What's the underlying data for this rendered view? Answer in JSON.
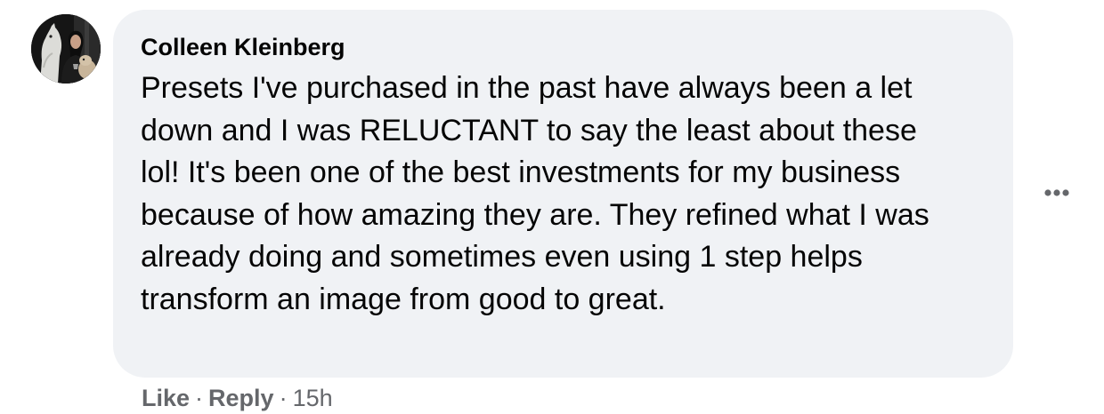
{
  "comment": {
    "author": "Colleen Kleinberg",
    "text": "Presets I've purchased in the past have always been a let down and I was RELUCTANT to say the least about these lol! It's been one of the best investments for my business because of how amazing they are. They refined what I was already doing and sometimes even using 1 step helps transform an image from good to great.",
    "avatar": "profile-photo-with-horse"
  },
  "actions": {
    "like_label": "Like",
    "separator": "·",
    "reply_label": "Reply",
    "timestamp": "15h"
  },
  "icons": {
    "more": "more-options-icon"
  },
  "colors": {
    "bubble": "#f0f2f5",
    "text": "#050505",
    "secondary_text": "#65676b"
  }
}
